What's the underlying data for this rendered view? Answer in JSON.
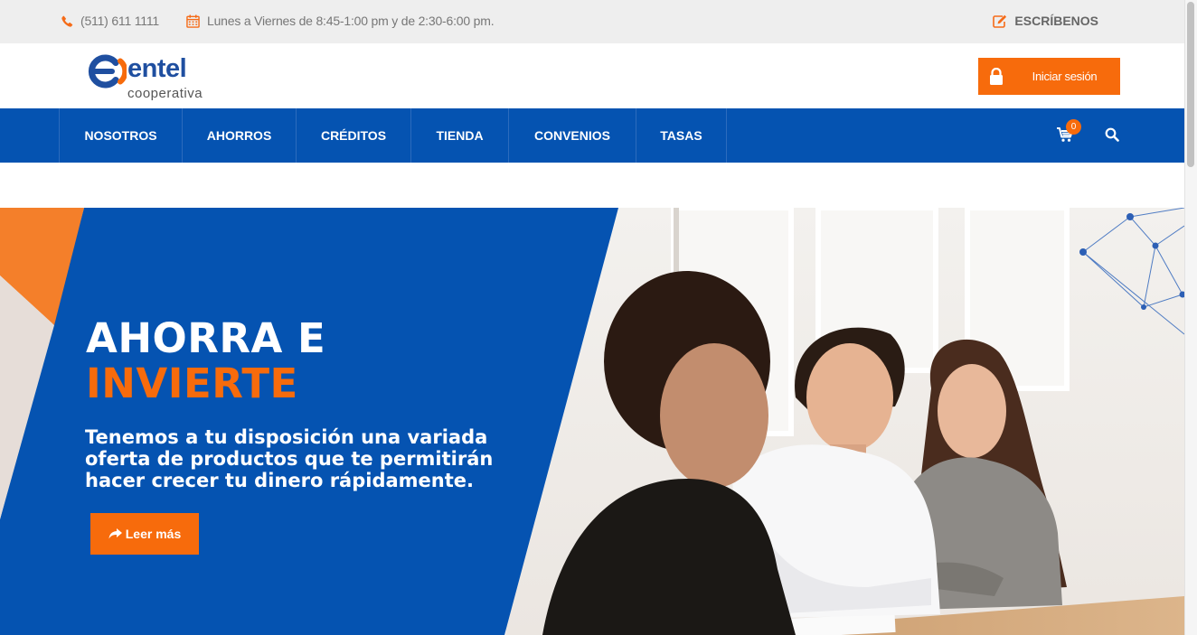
{
  "topbar": {
    "phone": "(511) 611 1111",
    "hours": "Lunes a Viernes de 8:45-1:00 pm y de 2:30-6:00 pm.",
    "write_label": "ESCRÍBENOS"
  },
  "header": {
    "logo_word": "entel",
    "logo_sub": "cooperativa",
    "login_label": "Iniciar sesión"
  },
  "nav": {
    "items": [
      {
        "label": "NOSOTROS"
      },
      {
        "label": "AHORROS"
      },
      {
        "label": "CRÉDITOS"
      },
      {
        "label": "TIENDA"
      },
      {
        "label": "CONVENIOS"
      },
      {
        "label": "TASAS"
      }
    ],
    "cart_count": "0"
  },
  "hero": {
    "title_line1": "AHORRA E",
    "title_line2": "INVIERTE",
    "text": "Tenemos a tu disposición una variada oferta de productos que te permitirán hacer crecer tu dinero rápidamente.",
    "cta_label": "Leer más"
  },
  "colors": {
    "brand_blue": "#0553b1",
    "brand_orange": "#f76b0c",
    "topbar_bg": "#eeeeee"
  },
  "icons": [
    "phone-icon",
    "calendar-icon",
    "edit-icon",
    "lock-icon",
    "cart-icon",
    "search-icon",
    "share-arrow-icon"
  ]
}
